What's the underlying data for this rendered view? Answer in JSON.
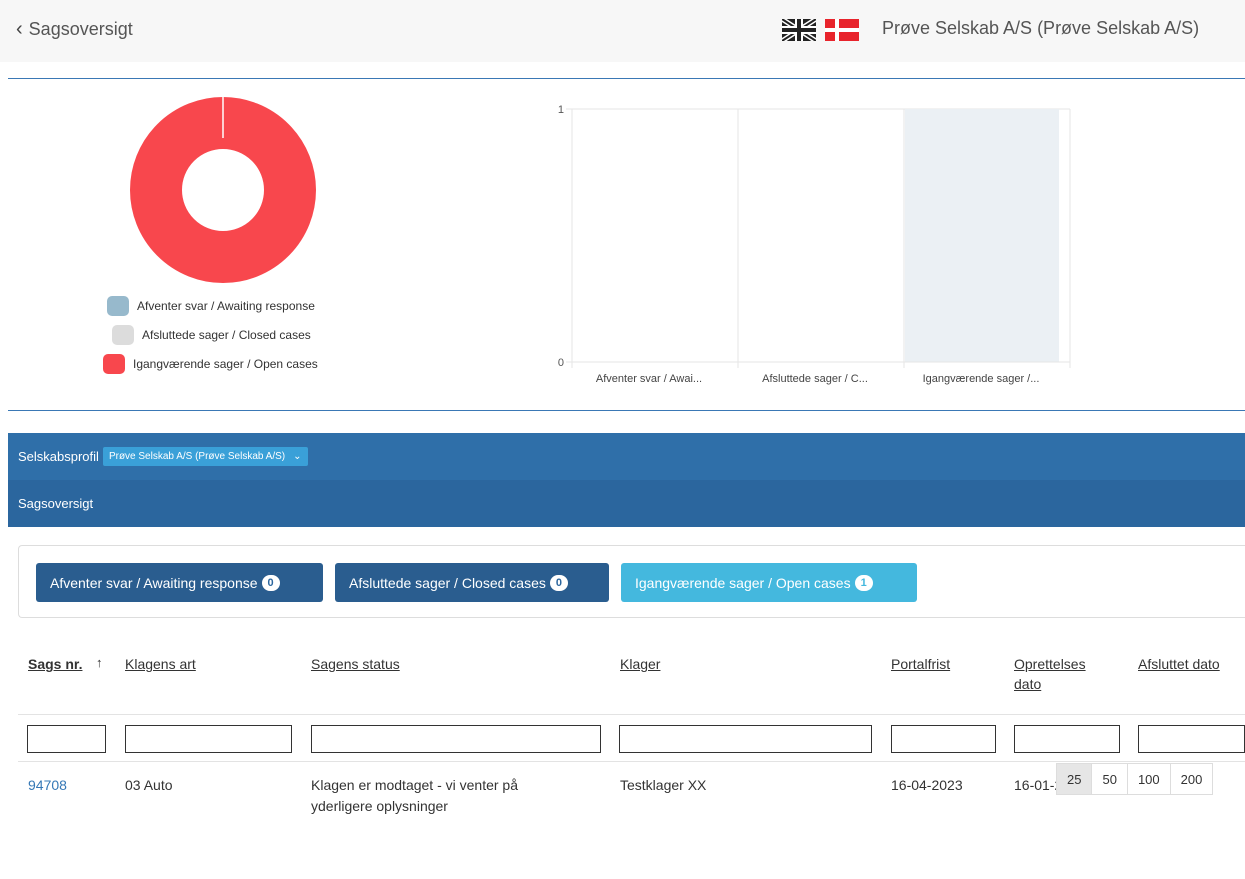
{
  "header": {
    "back_label": "Sagsoversigt",
    "company": "Prøve Selskab A/S (Prøve Selskab A/S)"
  },
  "donut": {
    "legend": [
      {
        "label": "Afventer svar / Awaiting response",
        "color": "#97b9cc"
      },
      {
        "label": "Afsluttede sager / Closed cases",
        "color": "#dcdcdc"
      },
      {
        "label": "Igangværende sager / Open cases",
        "color": "#f8474d"
      }
    ]
  },
  "chart_data": {
    "type": "bar",
    "categories": [
      "Afventer svar / Awai...",
      "Afsluttede sager / C...",
      "Igangværende sager /..."
    ],
    "values": [
      0,
      0,
      1
    ],
    "ylim": [
      0,
      1
    ],
    "yticks": [
      "1",
      "0"
    ],
    "bar_color": "#ebf0f4",
    "grid": true
  },
  "panel": {
    "profile_label": "Selskabsprofil",
    "profile_value": "Prøve Selskab A/S (Prøve Selskab A/S)",
    "section_title": "Sagsoversigt"
  },
  "filters": [
    {
      "label": "Afventer svar / Awaiting response",
      "count": "0"
    },
    {
      "label": "Afsluttede sager / Closed cases",
      "count": "0"
    },
    {
      "label": "Igangværende sager / Open cases",
      "count": "1"
    }
  ],
  "table": {
    "sort_arrow": "↑",
    "headers": [
      "Sags nr.",
      "Klagens art",
      "Sagens status",
      "Klager",
      "Portalfrist",
      "Oprettelses dato",
      "Afsluttet dato"
    ],
    "rows": [
      {
        "case_no": "94708",
        "type": "03 Auto",
        "status": "Klagen er modtaget - vi venter på yderligere oplysninger",
        "complainant": "Testklager XX",
        "deadline": "16-04-2023",
        "created": "16-01-2020",
        "closed": ""
      }
    ]
  },
  "pager": [
    "25",
    "50",
    "100",
    "200"
  ]
}
